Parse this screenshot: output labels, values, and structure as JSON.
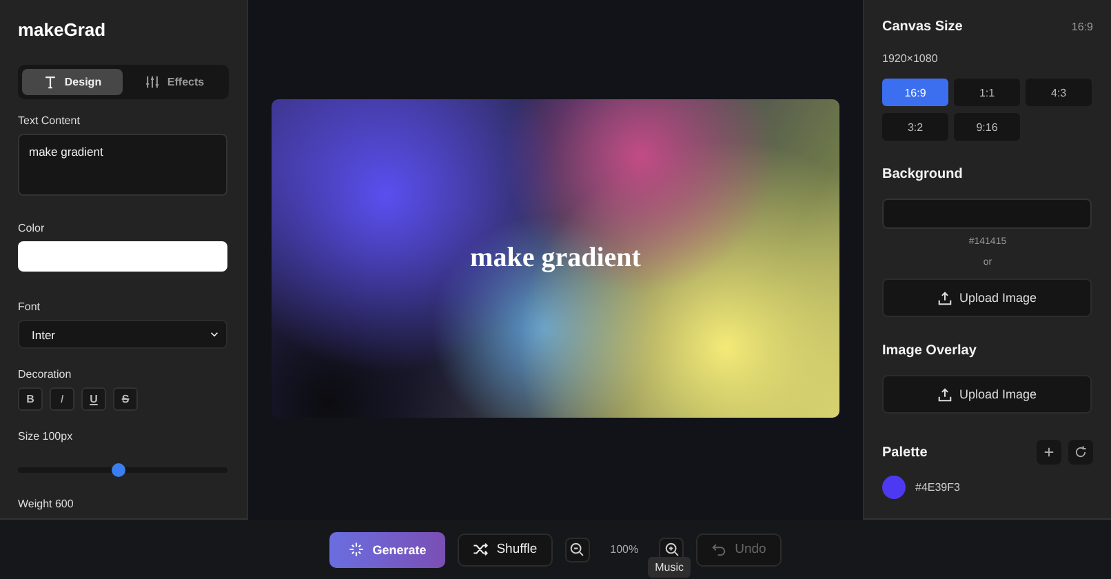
{
  "app": {
    "title": "makeGrad"
  },
  "tabs": [
    {
      "label": "Design",
      "kind": "type",
      "selected": true
    },
    {
      "label": "Effects",
      "kind": "sliders",
      "selected": false
    }
  ],
  "design": {
    "text_content": {
      "label": "Text Content",
      "value": "make gradient"
    },
    "color": {
      "label": "Color"
    },
    "font": {
      "label": "Font",
      "value": "Inter"
    },
    "decoration": {
      "label": "Decoration",
      "buttons": [
        "B",
        "I",
        "U",
        "S"
      ]
    },
    "size": {
      "label": "Size 100px",
      "level": 0.48
    },
    "weight": {
      "label": "Weight 600"
    }
  },
  "preview": {
    "text": "make gradient"
  },
  "toolbar": {
    "generate": "Generate",
    "shuffle": "Shuffle",
    "zoom": "100%",
    "undo": {
      "label": "Undo",
      "disabled": true
    },
    "tooltip": "Music"
  },
  "canvas_size": {
    "title": "Canvas Size",
    "ratio": "16:9",
    "resolution": "1920×1080",
    "options": [
      {
        "label": "16:9",
        "selected": true
      },
      {
        "label": "1:1",
        "selected": false
      },
      {
        "label": "4:3",
        "selected": false
      },
      {
        "label": "3:2",
        "selected": false
      },
      {
        "label": "9:16",
        "selected": false
      }
    ]
  },
  "background": {
    "title": "Background",
    "hex": "#141415",
    "or": "or",
    "upload": "Upload Image"
  },
  "overlay": {
    "title": "Image Overlay",
    "upload": "Upload Image"
  },
  "palette": {
    "title": "Palette",
    "colors": [
      {
        "label": "#4E39F3",
        "color": "#4e39f3"
      }
    ]
  }
}
